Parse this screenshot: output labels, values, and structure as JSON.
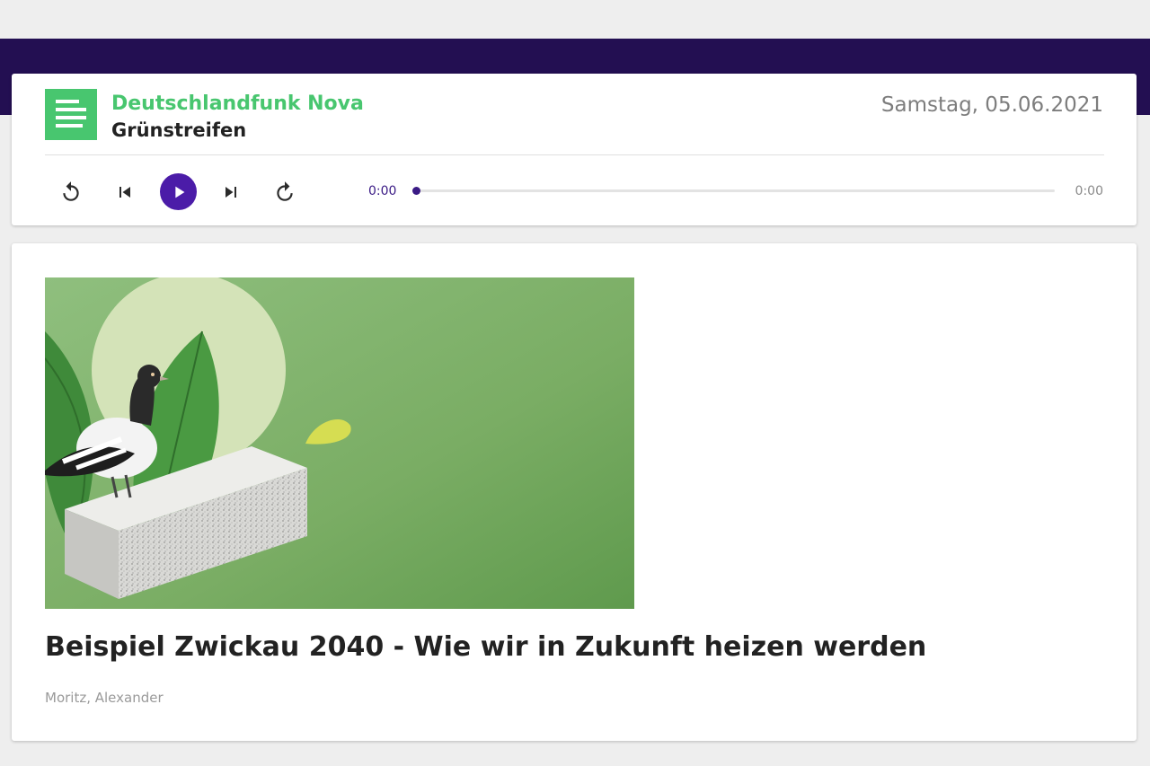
{
  "colors": {
    "brand_green": "#48c66f",
    "header_band": "#230f52",
    "play_accent": "#4b1ca8",
    "progress": "#3a1a85",
    "text_dark": "#222222",
    "text_muted": "#7d7d7d"
  },
  "header": {
    "logo_icon": "deutschlandfunk-logo-icon",
    "station_name": "Deutschlandfunk Nova",
    "show_name": "Grünstreifen",
    "date": "Samstag, 05.06.2021"
  },
  "player": {
    "controls": [
      {
        "name": "rewind-button",
        "icon": "replay-icon"
      },
      {
        "name": "previous-button",
        "icon": "skip-previous-icon"
      },
      {
        "name": "play-button",
        "icon": "play-icon"
      },
      {
        "name": "next-button",
        "icon": "skip-next-icon"
      },
      {
        "name": "forward-button",
        "icon": "forward-icon"
      }
    ],
    "current_time": "0:00",
    "duration": "0:00",
    "progress": 0
  },
  "article": {
    "image_icon": "pigeon-on-stone-illustration",
    "title": "Beispiel Zwickau 2040 - Wie wir in Zukunft heizen werden",
    "author": "Moritz, Alexander"
  }
}
